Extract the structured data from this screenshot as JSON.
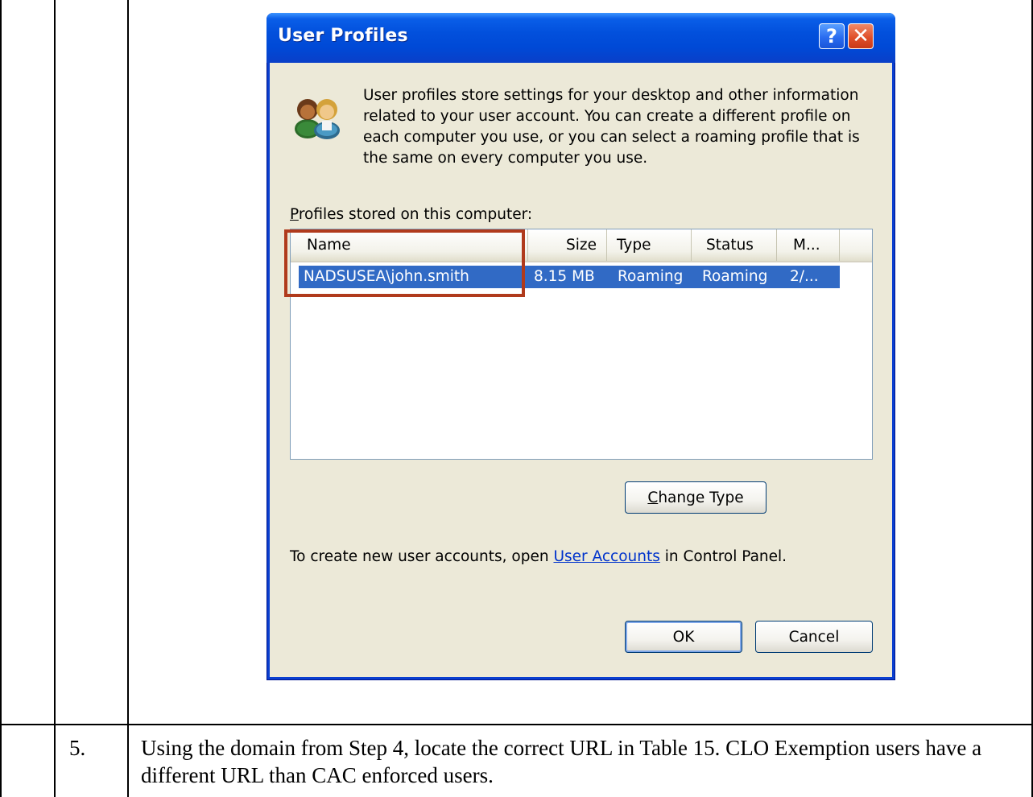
{
  "dialog": {
    "title": "User Profiles",
    "help_button": "?",
    "close_button": "✕",
    "info_text": "User profiles store settings for your desktop and other information related to your user account. You can create a different profile on each computer you use, or you can select a roaming profile that is the same on every computer you use.",
    "profiles_label_accel": "P",
    "profiles_label_rest": "rofiles stored on this computer:",
    "columns": [
      "Name",
      "Size",
      "Type",
      "Status",
      "M..."
    ],
    "rows": [
      {
        "name": "NADSUSEA\\john.smith",
        "size": "8.15 MB",
        "type": "Roaming",
        "status": "Roaming",
        "modified": "2/..."
      }
    ],
    "change_type_accel": "C",
    "change_type_rest": "hange Type",
    "footer_prefix": "To create new user accounts, open ",
    "footer_link": "User Accounts",
    "footer_suffix": " in Control Panel.",
    "ok_label": "OK",
    "cancel_label": "Cancel"
  },
  "step": {
    "number": "5.",
    "text": "Using the domain from Step 4, locate the correct URL in Table 15.  CLO Exemption users have a different URL than CAC enforced users."
  }
}
